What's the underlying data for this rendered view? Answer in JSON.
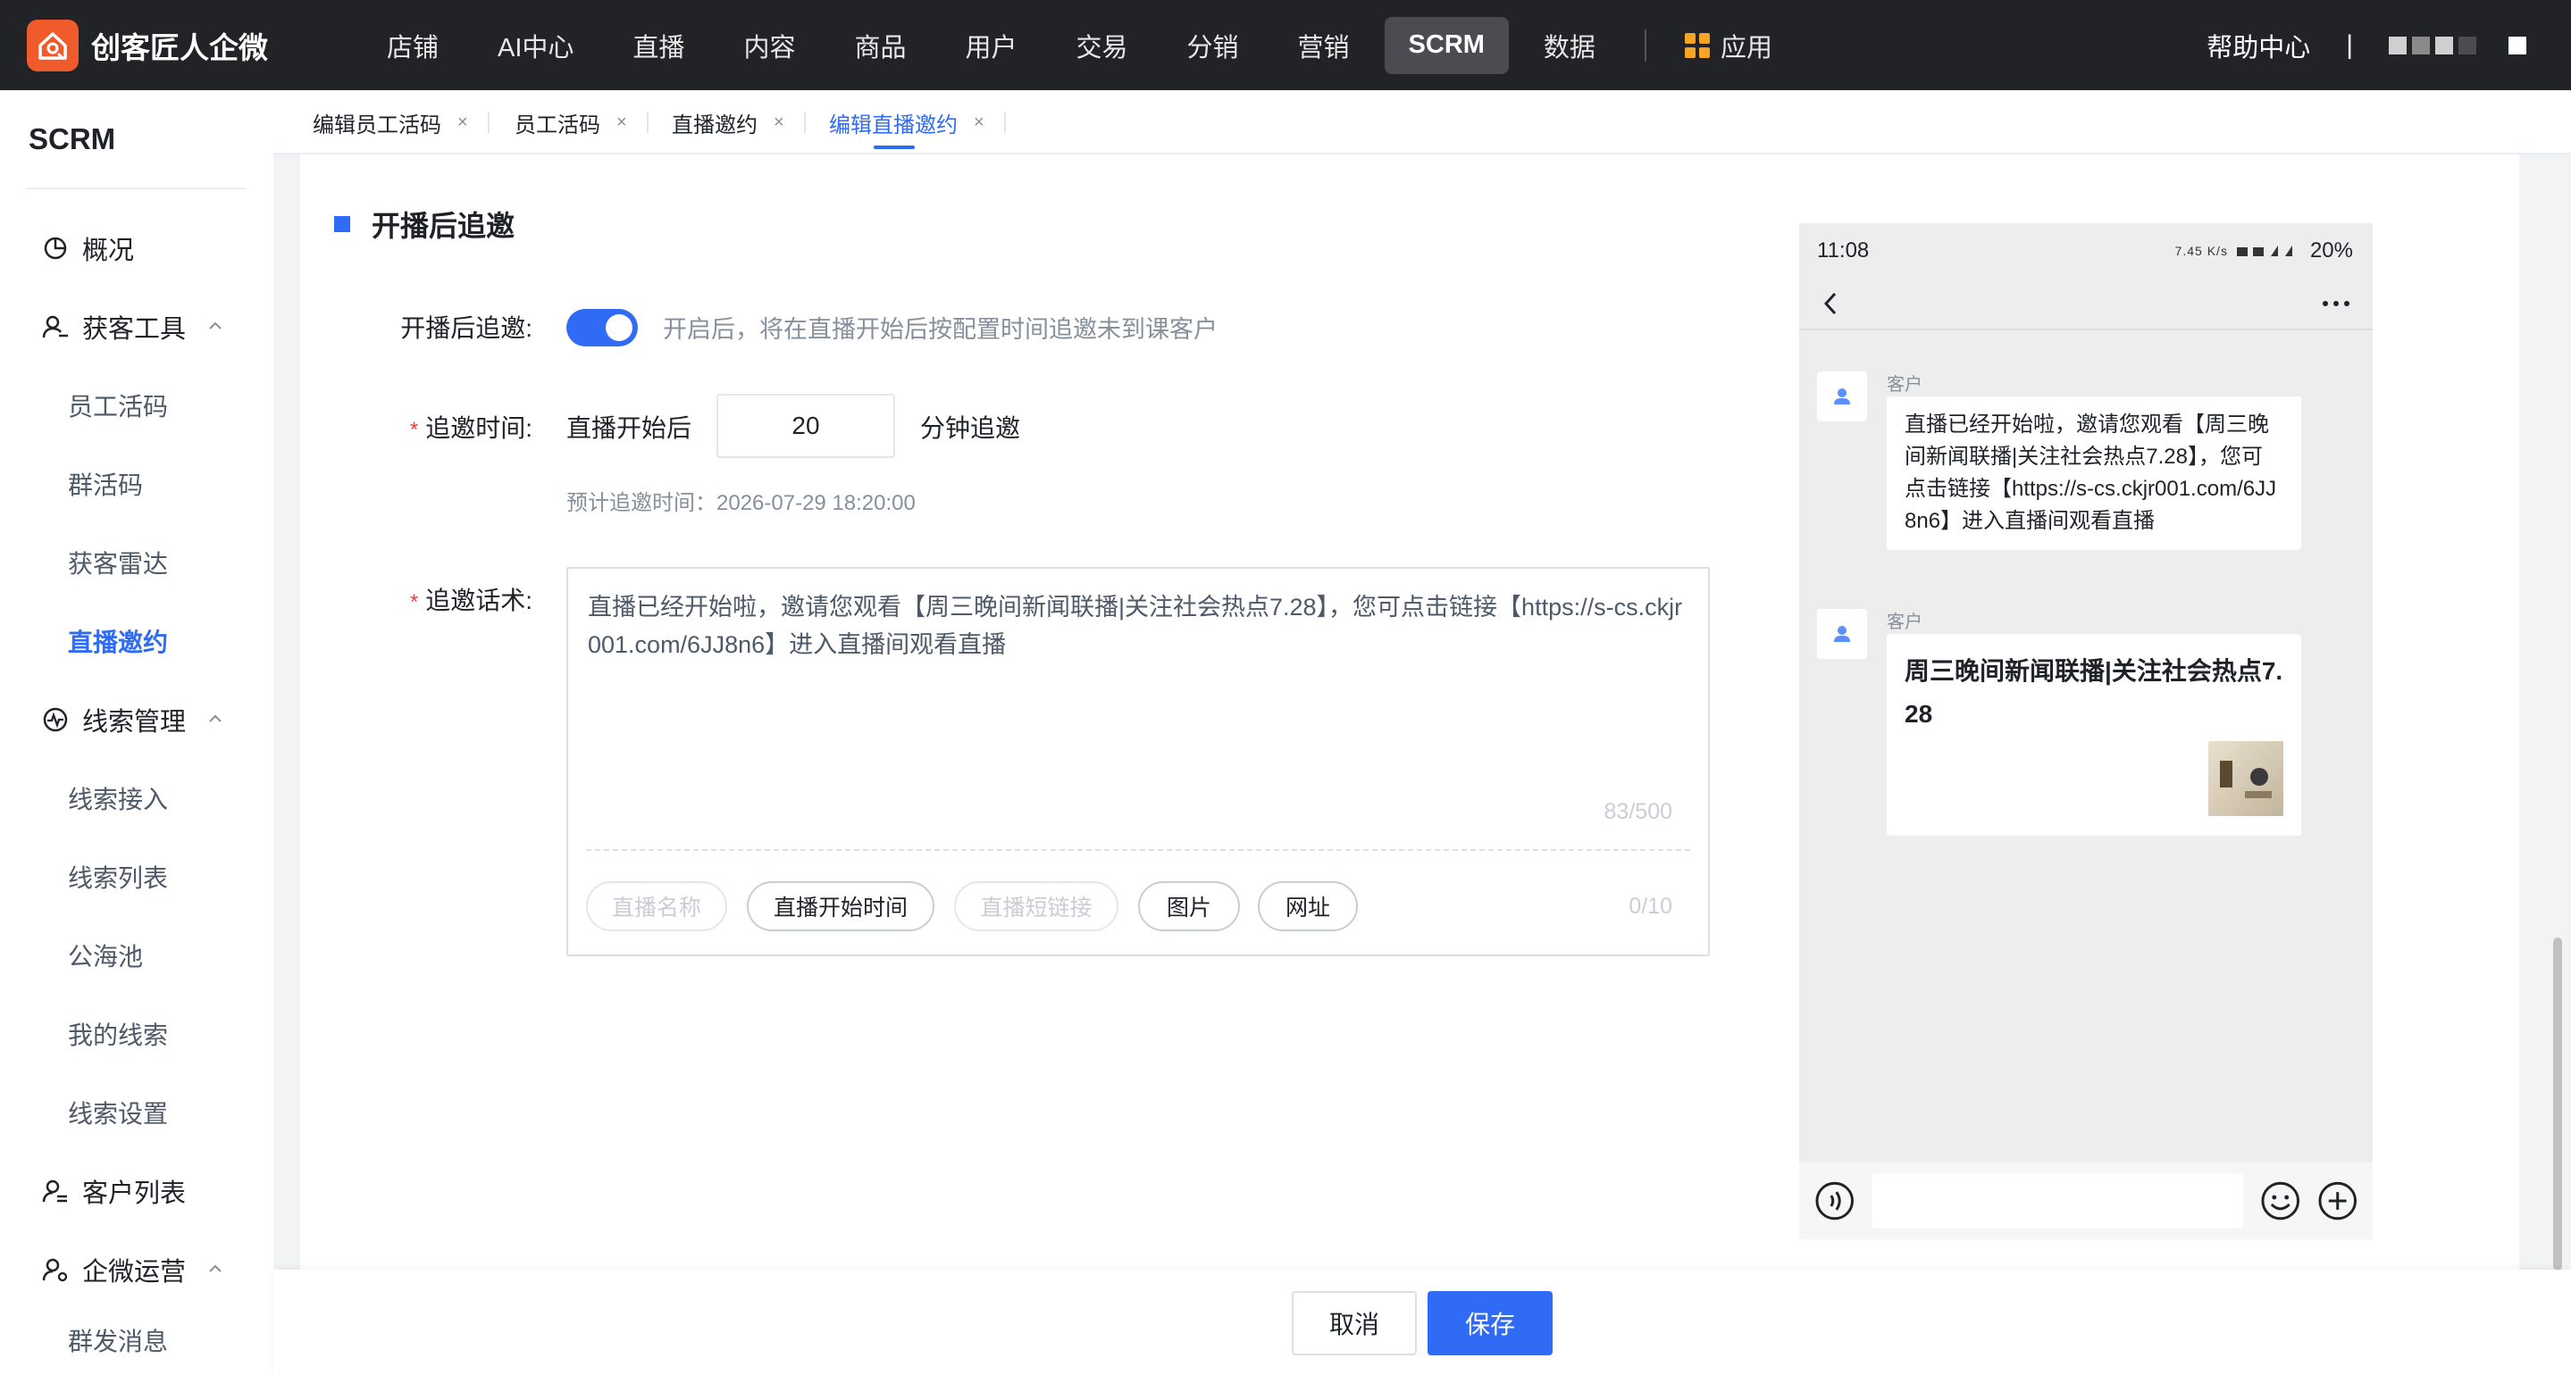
{
  "app": {
    "brand": "创客匠人企微"
  },
  "topnav": {
    "items": [
      "店铺",
      "AI中心",
      "直播",
      "内容",
      "商品",
      "用户",
      "交易",
      "分销",
      "营销",
      "SCRM",
      "数据"
    ],
    "active": "SCRM",
    "apps_label": "应用",
    "help": "帮助中心",
    "divider": "|"
  },
  "sidebar": {
    "title": "SCRM",
    "overview": "概况",
    "group1": {
      "label": "获客工具",
      "items": [
        "员工活码",
        "群活码",
        "获客雷达",
        "直播邀约"
      ]
    },
    "group2": {
      "label": "线索管理",
      "items": [
        "线索接入",
        "线索列表",
        "公海池",
        "我的线索",
        "线索设置"
      ]
    },
    "customer_list": "客户列表",
    "group3": {
      "label": "企微运营",
      "items": [
        "群发消息"
      ]
    },
    "active_item": "直播邀约"
  },
  "tabs": [
    {
      "label": "编辑员工活码"
    },
    {
      "label": "员工活码"
    },
    {
      "label": "直播邀约"
    },
    {
      "label": "编辑直播邀约"
    }
  ],
  "tab_close": "×",
  "section": {
    "title": "开播后追邀"
  },
  "form": {
    "toggle_label": "开播后追邀:",
    "toggle_on": true,
    "toggle_hint": "开启后，将在直播开始后按配置时间追邀未到课客户",
    "time_label": "追邀时间:",
    "time_prefix": "直播开始后",
    "time_value": "20",
    "time_suffix": "分钟追邀",
    "time_hint": "预计追邀时间：2026-07-29 18:20:00",
    "script_label": "追邀话术:",
    "script_text": "直播已经开始啦，邀请您观看【周三晚间新闻联播|关注社会热点7.28】，您可点击链接【https://s-cs.ckjr001.com/6JJ8n6】进入直播间观看直播",
    "script_count": "83/500",
    "chips": [
      "直播名称",
      "直播开始时间",
      "直播短链接",
      "图片",
      "网址"
    ],
    "chip_count": "0/10"
  },
  "phone": {
    "time": "11:08",
    "speed": "7.45 K/s",
    "battery": "20%",
    "msg1_name": "客户",
    "msg1_text": "直播已经开始啦，邀请您观看【周三晚间新闻联播|关注社会热点7.28】，您可点击链接【https://s-cs.ckjr001.com/6JJ8n6】进入直播间观看直播",
    "msg2_name": "客户",
    "msg2_title": "周三晚间新闻联播|关注社会热点7.28"
  },
  "footer": {
    "cancel": "取消",
    "save": "保存"
  },
  "colors": {
    "accent": "#2f6bf5",
    "nav_bg": "#222326",
    "brand": "#f05b2c",
    "required": "#f53f3f"
  }
}
